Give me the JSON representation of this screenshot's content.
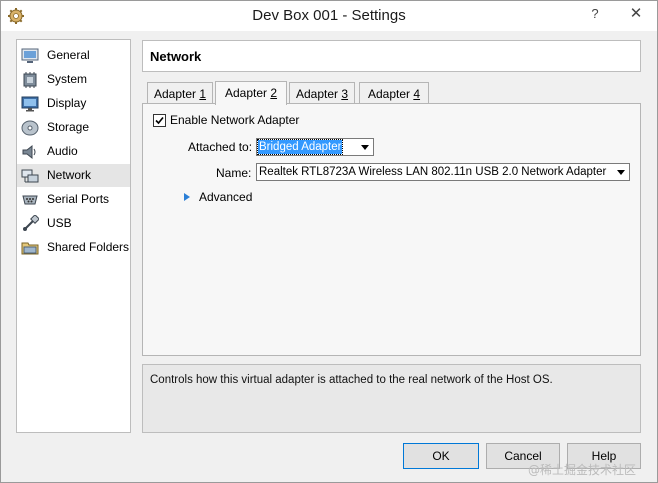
{
  "window": {
    "title": "Dev Box 001 - Settings",
    "help_button": "?",
    "close_button": "✕"
  },
  "sidebar": {
    "items": [
      {
        "label": "General",
        "icon": "general-icon"
      },
      {
        "label": "System",
        "icon": "system-icon"
      },
      {
        "label": "Display",
        "icon": "display-icon"
      },
      {
        "label": "Storage",
        "icon": "storage-icon"
      },
      {
        "label": "Audio",
        "icon": "audio-icon"
      },
      {
        "label": "Network",
        "icon": "network-icon",
        "selected": true
      },
      {
        "label": "Serial Ports",
        "icon": "serial-ports-icon"
      },
      {
        "label": "USB",
        "icon": "usb-icon"
      },
      {
        "label": "Shared Folders",
        "icon": "shared-folders-icon"
      }
    ]
  },
  "header": {
    "title": "Network"
  },
  "tabs": [
    {
      "label": "Adapter ",
      "mnemonic": "1"
    },
    {
      "label": "Adapter ",
      "mnemonic": "2",
      "active": true
    },
    {
      "label": "Adapter ",
      "mnemonic": "3"
    },
    {
      "label": "Adapter ",
      "mnemonic": "4"
    }
  ],
  "adapter": {
    "enable_checked": true,
    "enable_label": "Enable Network Adapter",
    "attached_label": "Attached to:",
    "attached_value": "Bridged Adapter",
    "name_label": "Name:",
    "name_value": "Realtek RTL8723A Wireless LAN 802.11n USB 2.0 Network Adapter",
    "advanced_label": "Advanced"
  },
  "description": "Controls how this virtual adapter is attached to the real network of the Host OS.",
  "buttons": {
    "ok": "OK",
    "cancel": "Cancel",
    "help": "Help"
  },
  "watermark": "@稀土掘金技术社区",
  "colors": {
    "selection": "#3399ff",
    "accent_border": "#0078d7"
  }
}
